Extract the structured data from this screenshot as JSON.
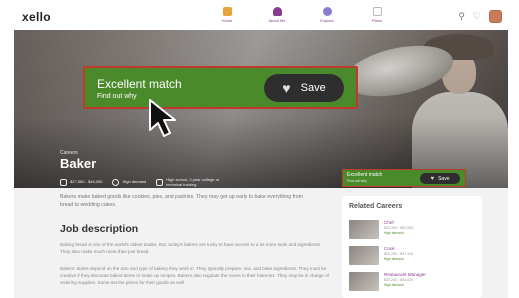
{
  "app": {
    "logo": "xello"
  },
  "nav": {
    "items": [
      {
        "label": "Home",
        "icon": "home-icon",
        "color": "#e8a33b"
      },
      {
        "label": "About Me",
        "icon": "person-icon",
        "color": "#8a3b8f"
      },
      {
        "label": "Explore",
        "icon": "compass-icon",
        "color": "#8a7bd0"
      },
      {
        "label": "Plans",
        "icon": "clipboard-icon",
        "color": "#b8b8b8"
      }
    ],
    "right_icons": [
      "search-icon",
      "heart-icon",
      "avatar"
    ]
  },
  "hero": {
    "category": "Careers",
    "title": "Baker",
    "stats": [
      {
        "icon": "money-icon",
        "text": "$27,560 - $46,050"
      },
      {
        "icon": "clock-icon",
        "text": "High demand"
      },
      {
        "icon": "graduation-icon",
        "text": "High school, 2-year college or technical training"
      }
    ]
  },
  "callout": {
    "title": "Excellent match",
    "link": "Find out why",
    "save_label": "Save"
  },
  "mini_callout": {
    "title": "Excellent match",
    "link": "Find out why",
    "save_label": "Save"
  },
  "content": {
    "intro": "Bakers make baked goods like cookies, pies, and pastries. They may get up early to bake everything from bread to wedding cakes.",
    "job_heading": "Job description",
    "paragraph1": "Baking bread is one of the world's oldest trades. But, today's bakers are lucky to have access to a lot more tools and ingredients. They also make much more than just bread.",
    "paragraph2": "Bakers' duties depend on the size and type of bakery they work in. They typically prepare, mix, and bake ingredients. They must be creative if they decorate baked items or make up recipes. Bakers also regulate the ovens in their bakeries. They may be in charge of ordering supplies. Some set the prices for their goods as well."
  },
  "related": {
    "title": "Related Careers",
    "items": [
      {
        "name": "Chef",
        "salary": "$26,390 - $80,050",
        "badge": "High demand"
      },
      {
        "name": "Cook",
        "salary": "$26,200 - $37,440",
        "badge": "High demand"
      },
      {
        "name": "Restaurant Manager",
        "salary": "$35,280 - $94,630",
        "badge": "High demand"
      }
    ]
  }
}
